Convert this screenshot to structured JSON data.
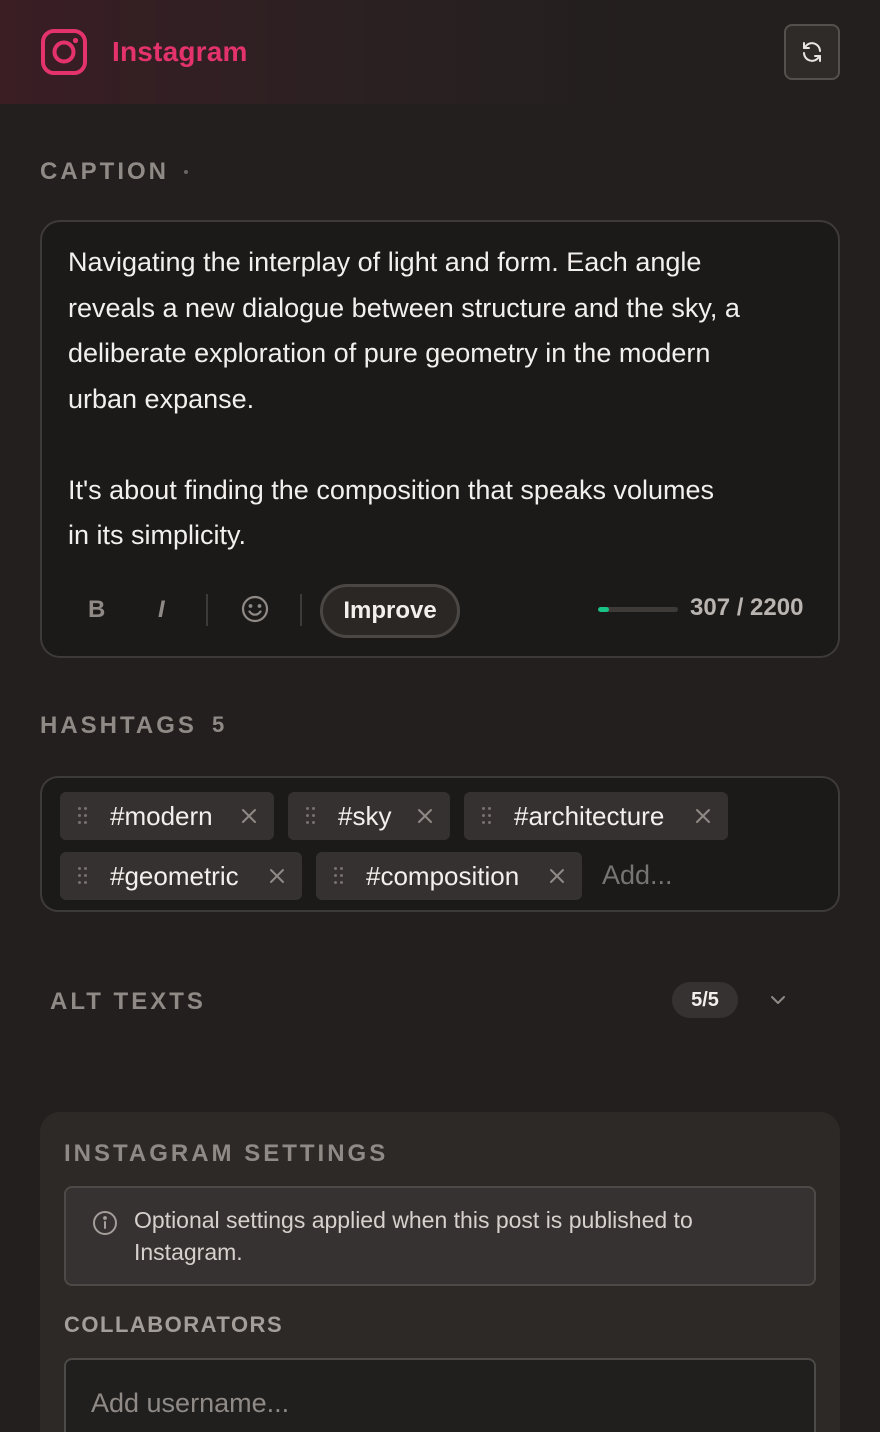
{
  "header": {
    "app_name": "Instagram",
    "brand_color": "#e4336c",
    "icon": "instagram-icon",
    "refresh_icon": "refresh-icon"
  },
  "caption": {
    "label": "CAPTION",
    "text": "Navigating the interplay of light and form. Each angle\nreveals a new dialogue between structure and the sky, a\ndeliberate exploration of pure geometry in the modern\nurban expanse.\n\nIt's about finding the composition that speaks volumes\nin its simplicity.",
    "toolbar": {
      "bold": "B",
      "italic": "I",
      "emoji_icon": "smiley-icon",
      "improve": "Improve"
    },
    "char_count": "307 / 2200",
    "progress": 0.14,
    "progress_color": "#18c485"
  },
  "hashtags": {
    "label": "HASHTAGS",
    "count": "5",
    "tags": [
      "#modern",
      "#sky",
      "#architecture",
      "#geometric",
      "#composition"
    ],
    "add_placeholder": "Add..."
  },
  "alt_texts": {
    "label": "ALT TEXTS",
    "badge": "5/5"
  },
  "instagram_settings": {
    "title": "INSTAGRAM SETTINGS",
    "info": "Optional settings applied when this post is published to Instagram.",
    "collaborators_label": "COLLABORATORS",
    "collaborators_placeholder": "Add username..."
  }
}
